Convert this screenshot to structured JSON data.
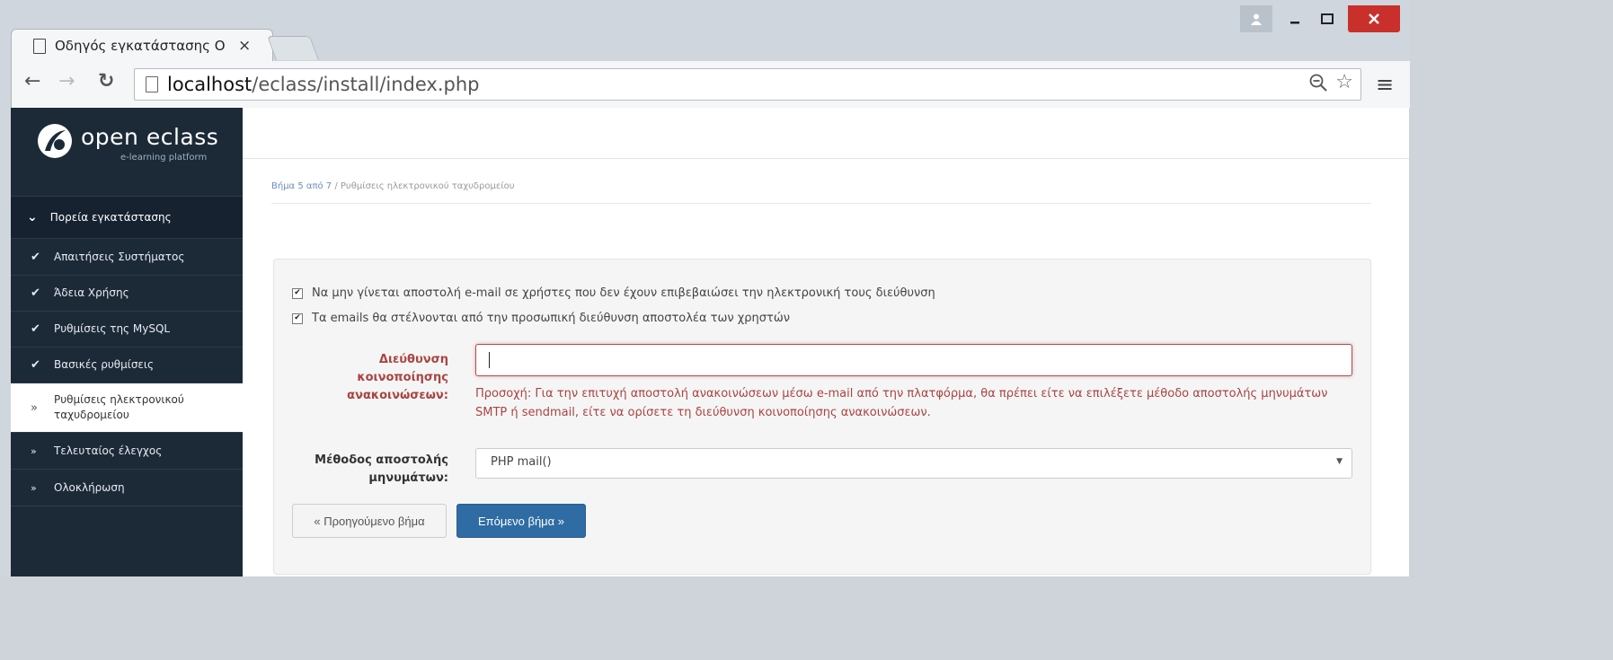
{
  "browser": {
    "tab_title": "Οδηγός εγκατάστασης Ο",
    "tab_close": "×",
    "url_host": "localhost",
    "url_path": "/eclass/install/index.php"
  },
  "logo": {
    "name": "open eclass",
    "tagline": "e-learning platform"
  },
  "sidebar": {
    "heading": "Πορεία εγκατάστασης",
    "items": [
      {
        "label": "Απαιτήσεις Συστήματος",
        "state": "done"
      },
      {
        "label": "Άδεια Χρήσης",
        "state": "done"
      },
      {
        "label": "Ρυθμίσεις της MySQL",
        "state": "done"
      },
      {
        "label": "Βασικές ρυθμίσεις",
        "state": "done"
      },
      {
        "label": "Ρυθμίσεις ηλεκτρονικού ταχυδρομείου",
        "state": "active"
      },
      {
        "label": "Τελευταίος έλεγχος",
        "state": "todo"
      },
      {
        "label": "Ολοκλήρωση",
        "state": "todo"
      }
    ]
  },
  "breadcrumb": {
    "step": "Βήμα 5 από 7",
    "separator": "/",
    "current": "Ρυθμίσεις ηλεκτρονικού ταχυδρομείου"
  },
  "form": {
    "checkbox1_label": "Να μην γίνεται αποστολή e-mail σε χρήστες που δεν έχουν επιβεβαιώσει την ηλεκτρονική τους διεύθυνση",
    "checkbox1_checked": true,
    "checkbox2_label": "Τα emails θα στέλνονται από την προσωπική διεύθυνση αποστολέα των χρηστών",
    "checkbox2_checked": true,
    "email_label": "Διεύθυνση κοινοποίησης ανακοινώσεων:",
    "email_value": "",
    "email_help": "Προσοχή: Για την επιτυχή αποστολή ανακοινώσεων μέσω e-mail από την πλατφόρμα, θα πρέπει είτε να επιλέξετε μέθοδο αποστολής μηνυμάτων SMTP ή sendmail, είτε να ορίσετε τη διεύθυνση κοινοποίησης ανακοινώσεων.",
    "method_label": "Μέθοδος αποστολής μηνυμάτων:",
    "method_value": "PHP mail()",
    "prev_button": "« Προηγούμενο βήμα",
    "next_button": "Επόμενο βήμα »"
  },
  "colors": {
    "sidebar_bg": "#1c2a38",
    "error": "#a94442",
    "primary_button": "#2f6ca3"
  }
}
